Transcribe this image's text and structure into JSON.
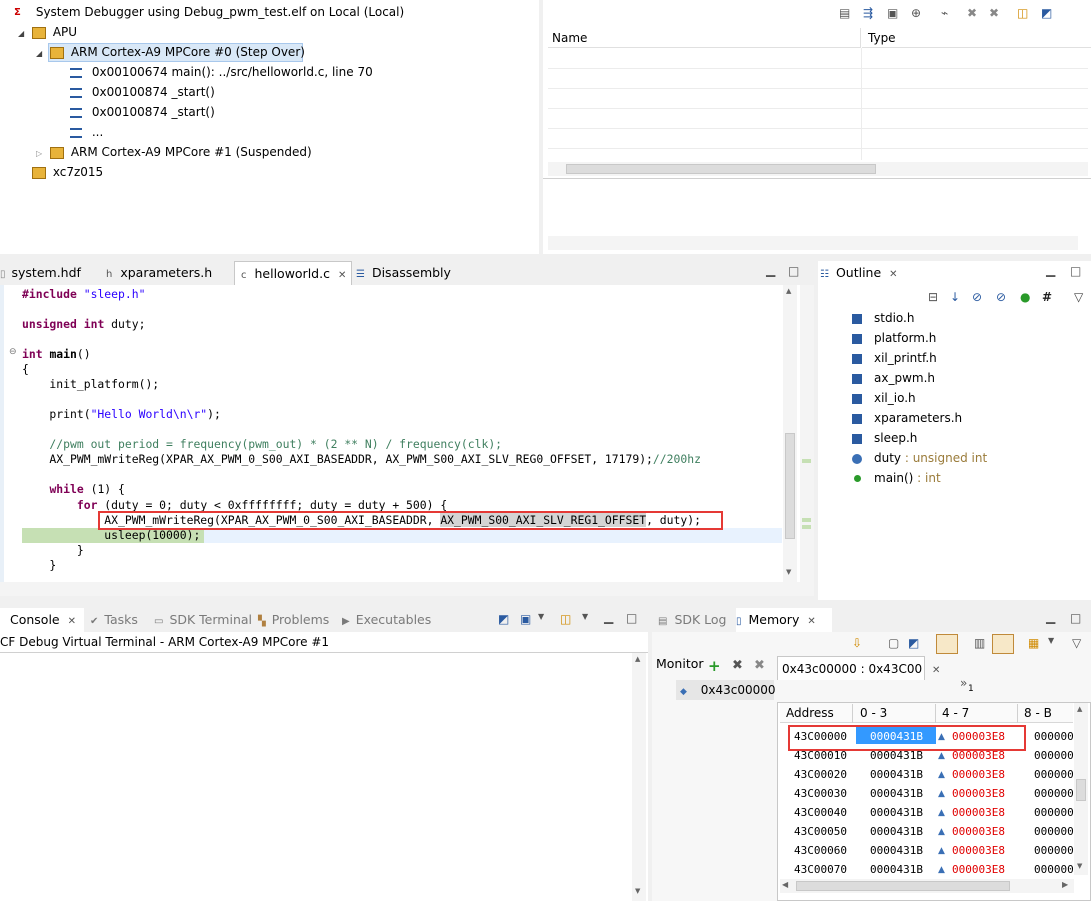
{
  "debug": {
    "root": "System Debugger using Debug_pwm_test.elf on Local (Local)",
    "apu": "APU",
    "core0": "ARM Cortex-A9 MPCore #0 (Step Over)",
    "frames": [
      "0x00100674 main(): ../src/helloworld.c, line 70",
      "0x00100874 _start()",
      "0x00100874 _start()",
      "..."
    ],
    "core1": "ARM Cortex-A9 MPCore #1 (Suspended)",
    "device": "xc7z015"
  },
  "variables": {
    "col_name": "Name",
    "col_type": "Type"
  },
  "editor": {
    "tabs": [
      "system.hdf",
      "xparameters.h",
      "helloworld.c",
      "Disassembly"
    ],
    "active_tab": "helloworld.c",
    "lines": [
      "#include \"sleep.h\"",
      "unsigned int duty;",
      "int main()",
      "{",
      "    init_platform();",
      "    print(\"Hello World\\n\\r\");",
      "    //pwm out period = frequency(pwm_out) * (2 ** N) / frequency(clk);",
      "    AX_PWM_mWriteReg(XPAR_AX_PWM_0_S00_AXI_BASEADDR, AX_PWM_S00_AXI_SLV_REG0_OFFSET, 17179);//200hz",
      "    while (1) {",
      "        for (duty = 0; duty < 0xffffffff; duty = duty + 500) {",
      "            AX_PWM_mWriteReg(XPAR_AX_PWM_0_S00_AXI_BASEADDR, AX_PWM_S00_AXI_SLV_REG1_OFFSET, duty);",
      "            usleep(10000);",
      "        }",
      "    }"
    ]
  },
  "outline": {
    "title": "Outline",
    "items": [
      {
        "name": "stdio.h",
        "type": ""
      },
      {
        "name": "platform.h",
        "type": ""
      },
      {
        "name": "xil_printf.h",
        "type": ""
      },
      {
        "name": "ax_pwm.h",
        "type": ""
      },
      {
        "name": "xil_io.h",
        "type": ""
      },
      {
        "name": "xparameters.h",
        "type": ""
      },
      {
        "name": "sleep.h",
        "type": ""
      },
      {
        "name": "duty",
        "type": " : unsigned int"
      },
      {
        "name": "main()",
        "type": " : int"
      }
    ]
  },
  "console": {
    "tabs": [
      "Console",
      "Tasks",
      "SDK Terminal",
      "Problems",
      "Executables"
    ],
    "title": "CF Debug Virtual Terminal - ARM Cortex-A9 MPCore #1"
  },
  "memory": {
    "tabs": [
      "SDK Log",
      "Memory"
    ],
    "monitor_label": "Monitor",
    "monitor_item": "0x43c00000",
    "rendering_tab": "0x43c00000 : 0x43C00",
    "overflow_count": "1",
    "headers": [
      "Address",
      "0 - 3",
      "4 - 7",
      "8 - B"
    ],
    "rows": [
      {
        "addr": "43C00000",
        "c0": "0000431B",
        "c1": "000003E8",
        "c2": "000000"
      },
      {
        "addr": "43C00010",
        "c0": "0000431B",
        "c1": "000003E8",
        "c2": "000000"
      },
      {
        "addr": "43C00020",
        "c0": "0000431B",
        "c1": "000003E8",
        "c2": "000000"
      },
      {
        "addr": "43C00030",
        "c0": "0000431B",
        "c1": "000003E8",
        "c2": "000000"
      },
      {
        "addr": "43C00040",
        "c0": "0000431B",
        "c1": "000003E8",
        "c2": "000000"
      },
      {
        "addr": "43C00050",
        "c0": "0000431B",
        "c1": "000003E8",
        "c2": "000000"
      },
      {
        "addr": "43C00060",
        "c0": "0000431B",
        "c1": "000003E8",
        "c2": "000000"
      },
      {
        "addr": "43C00070",
        "c0": "0000431B",
        "c1": "000003E8",
        "c2": "000000"
      }
    ]
  },
  "colors": {
    "highlight_box": "#e53935",
    "selection": "#3399ff",
    "changed_value": "#e00000",
    "current_line": "#c6e0b4"
  }
}
